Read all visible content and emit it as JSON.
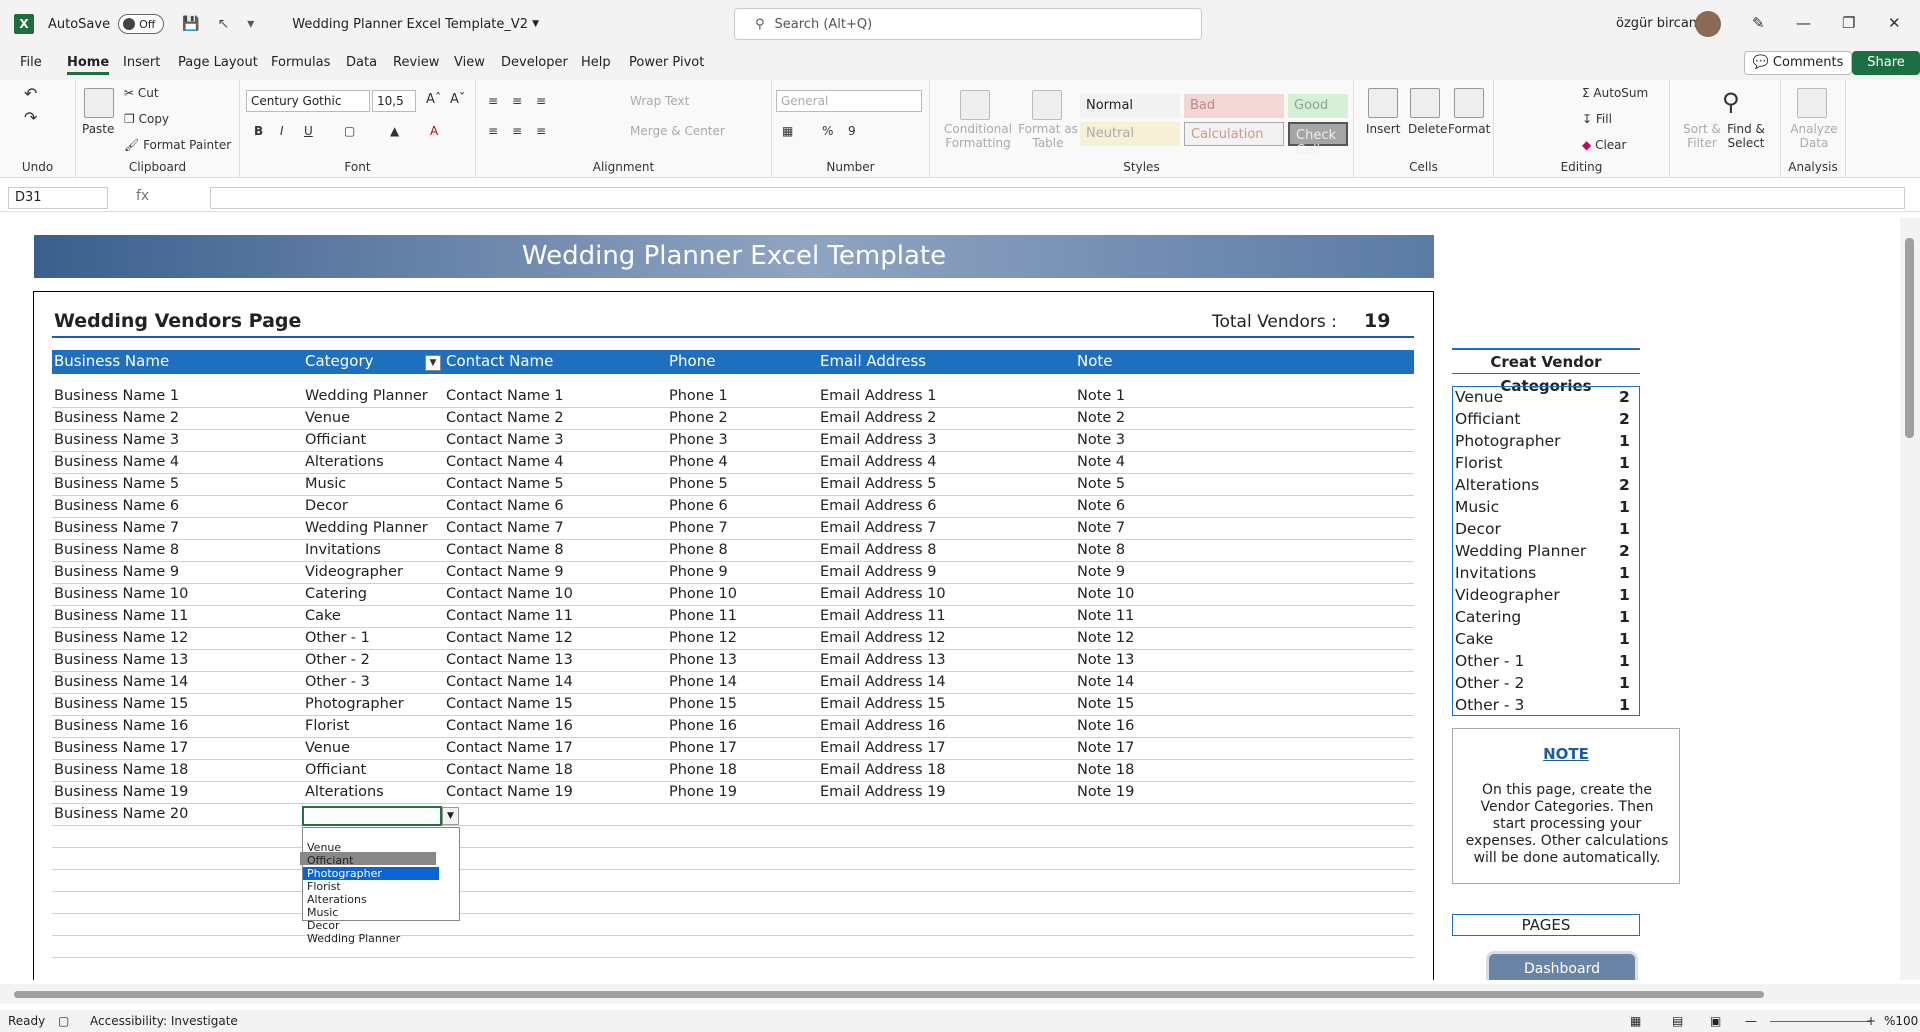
{
  "titlebar": {
    "autosave_label": "AutoSave",
    "autosave_state": "Off",
    "doc_title": "Wedding Planner Excel Template_V2",
    "search_placeholder": "Search (Alt+Q)",
    "user_name": "özgür bircan"
  },
  "menu": {
    "tabs": [
      "File",
      "Home",
      "Insert",
      "Page Layout",
      "Formulas",
      "Data",
      "Review",
      "View",
      "Developer",
      "Help",
      "Power Pivot"
    ],
    "active": "Home",
    "comments": "Comments",
    "share": "Share"
  },
  "ribbon": {
    "undo_group": "Undo",
    "clipboard": {
      "paste": "Paste",
      "cut": "Cut",
      "copy": "Copy",
      "format_painter": "Format Painter",
      "label": "Clipboard"
    },
    "font": {
      "name": "Century Gothic",
      "size": "10,5",
      "label": "Font",
      "bold": "B",
      "italic": "I",
      "underline": "U"
    },
    "alignment": {
      "wrap": "Wrap Text",
      "merge": "Merge & Center",
      "label": "Alignment"
    },
    "number": {
      "format": "General",
      "label": "Number",
      "percent": "%"
    },
    "styles": {
      "conditional": "Conditional Formatting",
      "format_table": "Format as Table",
      "normal": "Normal",
      "bad": "Bad",
      "good": "Good",
      "neutral": "Neutral",
      "calculation": "Calculation",
      "check_cell": "Check Cell",
      "label": "Styles"
    },
    "cells": {
      "insert": "Insert",
      "delete": "Delete",
      "format": "Format",
      "label": "Cells"
    },
    "editing": {
      "autosum": "AutoSum",
      "fill": "Fill",
      "clear": "Clear",
      "sort": "Sort & Filter",
      "find": "Find & Select",
      "label": "Editing"
    },
    "analysis": {
      "analyze": "Analyze Data",
      "label": "Analysis"
    }
  },
  "formula_bar": {
    "name_box": "D31",
    "fx": "fx",
    "value": ""
  },
  "sheet": {
    "banner": "Wedding Planner Excel Template",
    "page_title": "Wedding Vendors Page",
    "total_label": "Total Vendors :",
    "total_value": "19",
    "headers": [
      "Business Name",
      "Category",
      "Contact Name",
      "Phone",
      "Email Address",
      "Note"
    ],
    "rows": [
      [
        "Business Name 1",
        "Wedding Planner",
        "Contact Name 1",
        "Phone 1",
        "Email Address 1",
        "Note 1"
      ],
      [
        "Business Name 2",
        "Venue",
        "Contact Name 2",
        "Phone 2",
        "Email Address 2",
        "Note 2"
      ],
      [
        "Business Name 3",
        "Officiant",
        "Contact Name 3",
        "Phone 3",
        "Email Address 3",
        "Note 3"
      ],
      [
        "Business Name 4",
        "Alterations",
        "Contact Name 4",
        "Phone 4",
        "Email Address 4",
        "Note 4"
      ],
      [
        "Business Name 5",
        "Music",
        "Contact Name 5",
        "Phone 5",
        "Email Address 5",
        "Note 5"
      ],
      [
        "Business Name 6",
        "Decor",
        "Contact Name 6",
        "Phone 6",
        "Email Address 6",
        "Note 6"
      ],
      [
        "Business Name 7",
        "Wedding Planner",
        "Contact Name 7",
        "Phone 7",
        "Email Address 7",
        "Note 7"
      ],
      [
        "Business Name 8",
        "Invitations",
        "Contact Name 8",
        "Phone 8",
        "Email Address 8",
        "Note 8"
      ],
      [
        "Business Name 9",
        "Videographer",
        "Contact Name 9",
        "Phone 9",
        "Email Address 9",
        "Note 9"
      ],
      [
        "Business Name 10",
        "Catering",
        "Contact Name 10",
        "Phone 10",
        "Email Address 10",
        "Note 10"
      ],
      [
        "Business Name 11",
        "Cake",
        "Contact Name 11",
        "Phone 11",
        "Email Address 11",
        "Note 11"
      ],
      [
        "Business Name 12",
        "Other - 1",
        "Contact Name 12",
        "Phone 12",
        "Email Address 12",
        "Note 12"
      ],
      [
        "Business Name 13",
        "Other - 2",
        "Contact Name 13",
        "Phone 13",
        "Email Address 13",
        "Note 13"
      ],
      [
        "Business Name 14",
        "Other - 3",
        "Contact Name 14",
        "Phone 14",
        "Email Address 14",
        "Note 14"
      ],
      [
        "Business Name 15",
        "Photographer",
        "Contact Name 15",
        "Phone 15",
        "Email Address 15",
        "Note 15"
      ],
      [
        "Business Name 16",
        "Florist",
        "Contact Name 16",
        "Phone 16",
        "Email Address 16",
        "Note 16"
      ],
      [
        "Business Name 17",
        "Venue",
        "Contact Name 17",
        "Phone 17",
        "Email Address 17",
        "Note 17"
      ],
      [
        "Business Name 18",
        "Officiant",
        "Contact Name 18",
        "Phone 18",
        "Email Address 18",
        "Note 18"
      ],
      [
        "Business Name 19",
        "Alterations",
        "Contact Name 19",
        "Phone 19",
        "Email Address 19",
        "Note 19"
      ],
      [
        "Business Name 20",
        "",
        "",
        "",
        "",
        ""
      ]
    ],
    "dropdown_options": [
      "Venue",
      "Officiant",
      "Photographer",
      "Florist",
      "Alterations",
      "Music",
      "Decor",
      "Wedding Planner"
    ],
    "dropdown_selected": "Photographer",
    "categories_title": "Creat Vendor Categories",
    "categories": [
      [
        "Venue",
        "2"
      ],
      [
        "Officiant",
        "2"
      ],
      [
        "Photographer",
        "1"
      ],
      [
        "Florist",
        "1"
      ],
      [
        "Alterations",
        "2"
      ],
      [
        "Music",
        "1"
      ],
      [
        "Decor",
        "1"
      ],
      [
        "Wedding Planner",
        "2"
      ],
      [
        "Invitations",
        "1"
      ],
      [
        "Videographer",
        "1"
      ],
      [
        "Catering",
        "1"
      ],
      [
        "Cake",
        "1"
      ],
      [
        "Other - 1",
        "1"
      ],
      [
        "Other - 2",
        "1"
      ],
      [
        "Other - 3",
        "1"
      ]
    ],
    "note_title": "NOTE",
    "note_text": "On this page, create the Vendor Categories. Then start processing your expenses. Other calculations will be done automatically.",
    "pages_title": "PAGES",
    "dashboard_button": "Dashboard"
  },
  "status": {
    "ready": "Ready",
    "accessibility": "Accessibility: Investigate",
    "zoom": "%100"
  }
}
